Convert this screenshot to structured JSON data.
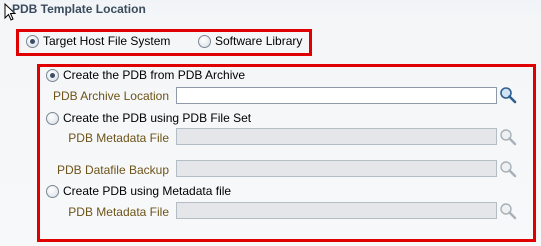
{
  "title": "PDB Template Location",
  "location": {
    "options": [
      {
        "label": "Target Host File System",
        "selected": true
      },
      {
        "label": "Software Library",
        "selected": false
      }
    ]
  },
  "source": {
    "options": [
      {
        "label": "Create the PDB from PDB Archive",
        "selected": true
      },
      {
        "label": "Create the PDB using PDB File Set",
        "selected": false
      },
      {
        "label": "Create PDB using Metadata file",
        "selected": false
      }
    ],
    "fields": {
      "archive_location": {
        "label": "PDB Archive Location",
        "value": "",
        "enabled": true
      },
      "fileset_metadata": {
        "label": "PDB Metadata File",
        "value": "",
        "enabled": false
      },
      "datafile_backup": {
        "label": "PDB Datafile Backup",
        "value": "",
        "enabled": false
      },
      "metadata_file": {
        "label": "PDB Metadata File",
        "value": "",
        "enabled": false
      }
    }
  },
  "icons": {
    "search": "search-icon",
    "cursor": "mouse-pointer-icon"
  },
  "colors": {
    "highlight_border": "#e00000",
    "field_label": "#6d5418",
    "title": "#3b4b5c"
  }
}
